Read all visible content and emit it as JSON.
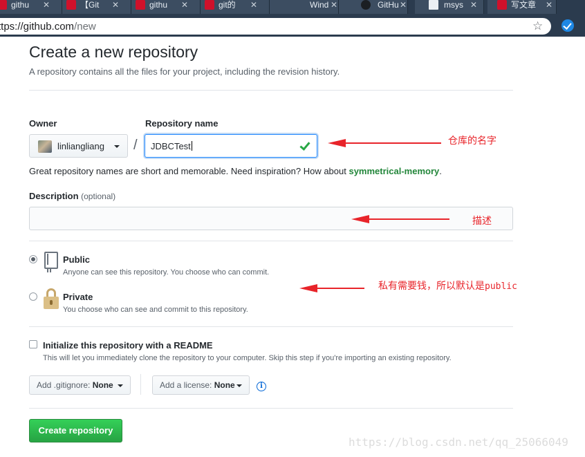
{
  "browser": {
    "tabs": [
      {
        "title": "githu",
        "icon": "csdn-icon"
      },
      {
        "title": "【Git",
        "icon": "csdn-icon"
      },
      {
        "title": "githu",
        "icon": "csdn-icon"
      },
      {
        "title": "git的",
        "icon": "csdn-icon"
      },
      {
        "title": "Wind",
        "icon": "windows-icon"
      },
      {
        "title": "GitHu",
        "icon": "github-icon"
      },
      {
        "title": "msys",
        "icon": "document-icon"
      },
      {
        "title": "写文章",
        "icon": "csdn-icon"
      }
    ],
    "url_host": "ttps://github.com",
    "url_path": "/new"
  },
  "page": {
    "title": "Create a new repository",
    "subtitle": "A repository contains all the files for your project, including the revision history."
  },
  "form": {
    "owner_label": "Owner",
    "owner_name": "linliangliang",
    "repo_label": "Repository name",
    "repo_value": "JDBCTest",
    "hint_prefix": "Great repository names are short and memorable. Need inspiration? How about ",
    "hint_suggestion": "symmetrical-memory",
    "hint_suffix": ".",
    "description_label": "Description",
    "description_optional": "(optional)",
    "description_value": "",
    "visibility": [
      {
        "title": "Public",
        "note": "Anyone can see this repository. You choose who can commit.",
        "selected": true
      },
      {
        "title": "Private",
        "note": "You choose who can see and commit to this repository.",
        "selected": false
      }
    ],
    "readme_label": "Initialize this repository with a README",
    "readme_note": "This will let you immediately clone the repository to your computer. Skip this step if you're importing an existing repository.",
    "readme_checked": false,
    "gitignore_label": "Add .gitignore:",
    "gitignore_value": "None",
    "license_label": "Add a license:",
    "license_value": "None",
    "info_glyph": "i",
    "submit_label": "Create repository"
  },
  "annotations": {
    "repo_name_note": "仓库的名字",
    "description_note": "描述",
    "visibility_note_prefix": "私有需要钱，所以默认是",
    "visibility_note_code": "public",
    "color": "#e8242a"
  },
  "watermark": "https://blog.csdn.net/qq_25066049",
  "colors": {
    "create_button": "#28a745",
    "suggestion": "#22863a",
    "focus_border": "#2188ff",
    "chrome": "#2b3b4e"
  }
}
